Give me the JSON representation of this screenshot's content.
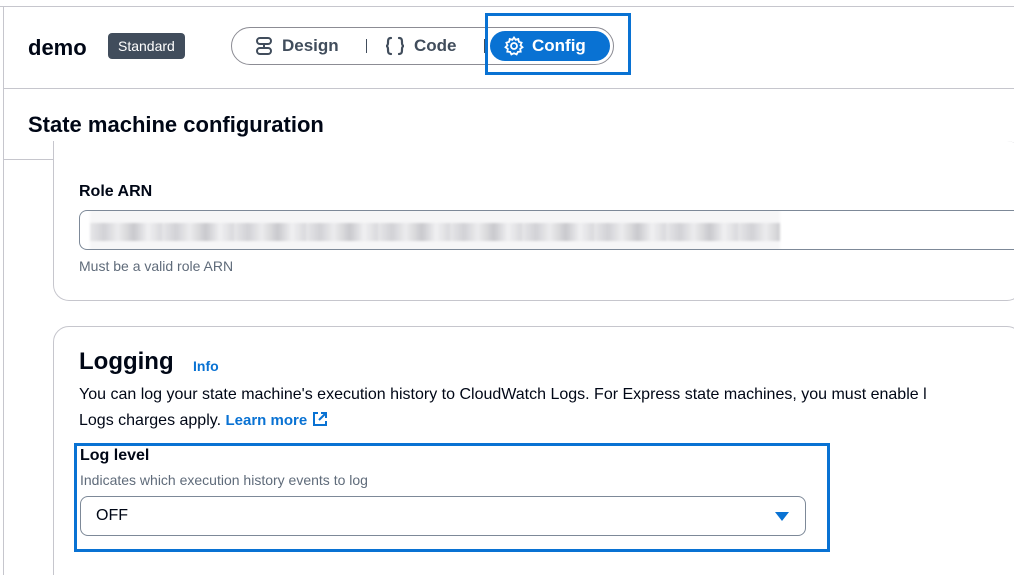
{
  "header": {
    "state_machine_name": "demo",
    "type_badge": "Standard",
    "tabs": [
      {
        "label": "Design",
        "icon": "design-icon",
        "selected": false
      },
      {
        "label": "Code",
        "icon": "code-braces-icon",
        "selected": false
      },
      {
        "label": "Config",
        "icon": "gear-icon",
        "selected": true
      }
    ]
  },
  "page": {
    "title": "State machine configuration"
  },
  "role": {
    "label": "Role ARN",
    "value": "",
    "hint": "Must be a valid role ARN"
  },
  "logging": {
    "title": "Logging",
    "info_link": "Info",
    "description_line1": "You can log your state machine's execution history to CloudWatch Logs. For Express state machines, you must enable l",
    "description_line2": "Logs charges apply.",
    "learn_more": "Learn more",
    "log_level": {
      "label": "Log level",
      "description": "Indicates which execution history events to log",
      "selected": "OFF"
    }
  },
  "colors": {
    "accent": "#0972d3",
    "badge_bg": "#414d5c",
    "text": "#000716",
    "secondary_text": "#5f6b7a",
    "border": "#c6c6cd"
  }
}
